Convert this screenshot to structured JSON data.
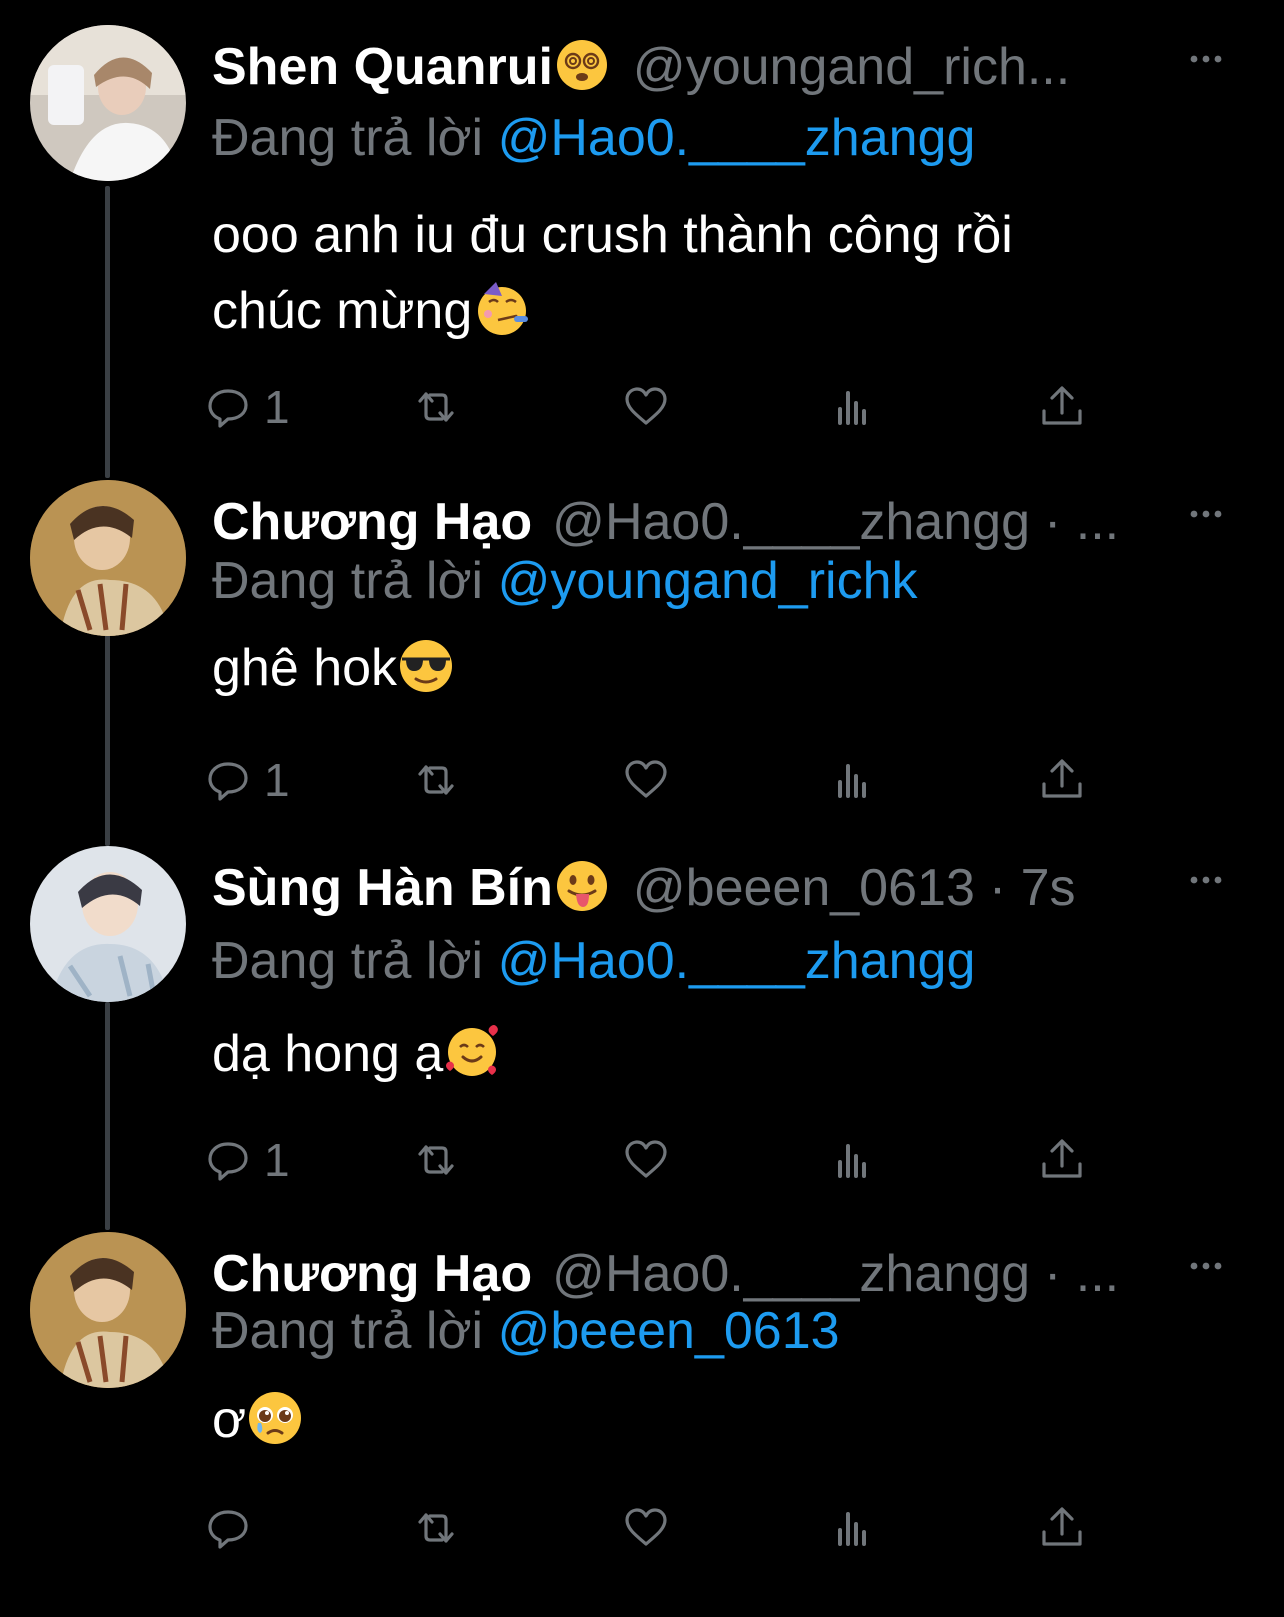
{
  "replying_prefix": "Đang trả lời",
  "colors": {
    "background": "#000000",
    "text": "#ffffff",
    "muted": "#71767b",
    "link": "#1d9bf0",
    "thread_line": "#3a3f44"
  },
  "tweets": [
    {
      "display_name": "Shen Quanrui",
      "name_emoji": "dizzy-face-emoji",
      "handle": "@youngand_rich...",
      "meta": "",
      "reply_to": "@Hao0.____zhangg",
      "text_lines": [
        "ooo anh iu đu crush thành công rồi",
        "chúc mừng"
      ],
      "text_emoji": "partying-face-emoji",
      "reply_count": "1"
    },
    {
      "display_name": "Chương Hạo",
      "name_emoji": "",
      "handle": "@Hao0.____zhangg",
      "meta": "· ...",
      "reply_to": "@youngand_richk",
      "text_lines": [
        "ghê hok"
      ],
      "text_emoji": "sunglasses-face-emoji",
      "reply_count": "1"
    },
    {
      "display_name": "Sùng Hàn Bín",
      "name_emoji": "tongue-face-emoji",
      "handle": "@beeen_0613",
      "meta": "· 7s",
      "reply_to": "@Hao0.____zhangg",
      "text_lines": [
        "dạ hong ạ"
      ],
      "text_emoji": "smiling-face-with-hearts-emoji",
      "reply_count": "1"
    },
    {
      "display_name": "Chương Hạo",
      "name_emoji": "",
      "handle": "@Hao0.____zhangg",
      "meta": "· ...",
      "reply_to": "@beeen_0613",
      "text_lines": [
        "ơ"
      ],
      "text_emoji": "pleading-face-emoji",
      "reply_count": ""
    }
  ]
}
